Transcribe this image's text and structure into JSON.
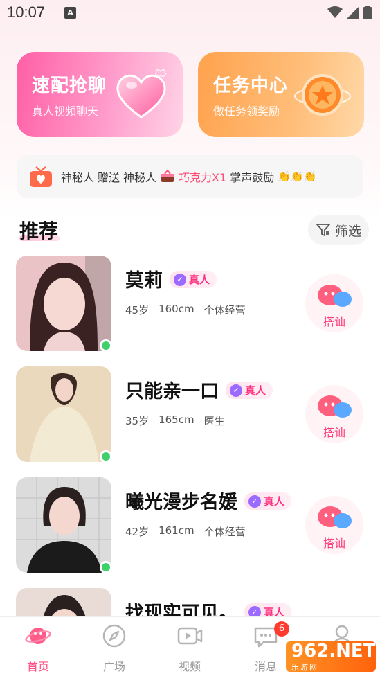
{
  "status_bar": {
    "time": "10:07",
    "notification_letter": "A"
  },
  "cards": [
    {
      "title": "速配抢聊",
      "subtitle": "真人视频聊天",
      "icon": "heart-icon",
      "gradient": [
        "#ff5fa5",
        "#ffd3e6"
      ]
    },
    {
      "title": "任务中心",
      "subtitle": "做任务领奖励",
      "icon": "coin-star-icon",
      "gradient": [
        "#ffa24d",
        "#ffd9a8"
      ]
    }
  ],
  "banner": {
    "sender": "神秘人",
    "verb": "赠送",
    "receiver": "神秘人",
    "gift": "巧克力X1",
    "message": "掌声鼓励",
    "emoji": "👏👏👏"
  },
  "section": {
    "title": "推荐",
    "filter_label": "筛选"
  },
  "users": [
    {
      "name": "莫莉",
      "badge": "真人",
      "age": "45岁",
      "height": "160cm",
      "job": "个体经营",
      "chat_label": "搭讪",
      "online": true,
      "avatar_tone": [
        "#f4c6c9",
        "#6a3a3a"
      ]
    },
    {
      "name": "只能亲一口",
      "badge": "真人",
      "age": "35岁",
      "height": "165cm",
      "job": "医生",
      "chat_label": "搭讪",
      "online": true,
      "avatar_tone": [
        "#ead9bd",
        "#3a2a22"
      ]
    },
    {
      "name": "曦光漫步名媛",
      "badge": "真人",
      "age": "42岁",
      "height": "161cm",
      "job": "个体经营",
      "chat_label": "搭讪",
      "online": true,
      "avatar_tone": [
        "#d8d8d8",
        "#2a2222"
      ]
    },
    {
      "name": "找现实可见。",
      "badge": "真人",
      "age": "",
      "height": "",
      "job": "",
      "chat_label": "",
      "online": false,
      "avatar_tone": [
        "#e9dcd6",
        "#2a2020"
      ]
    }
  ],
  "nav": [
    {
      "label": "首页",
      "icon": "planet-icon",
      "active": true
    },
    {
      "label": "广场",
      "icon": "compass-icon",
      "active": false
    },
    {
      "label": "视频",
      "icon": "video-icon",
      "active": false
    },
    {
      "label": "消息",
      "icon": "message-icon",
      "active": false,
      "badge": "6"
    },
    {
      "label": "",
      "icon": "profile-icon",
      "active": false
    }
  ],
  "watermark": {
    "text": "962.NET",
    "sub": "乐游网"
  },
  "colors": {
    "accent": "#ff4f84",
    "online": "#3fcf6b",
    "badge": "#ff3b30"
  }
}
